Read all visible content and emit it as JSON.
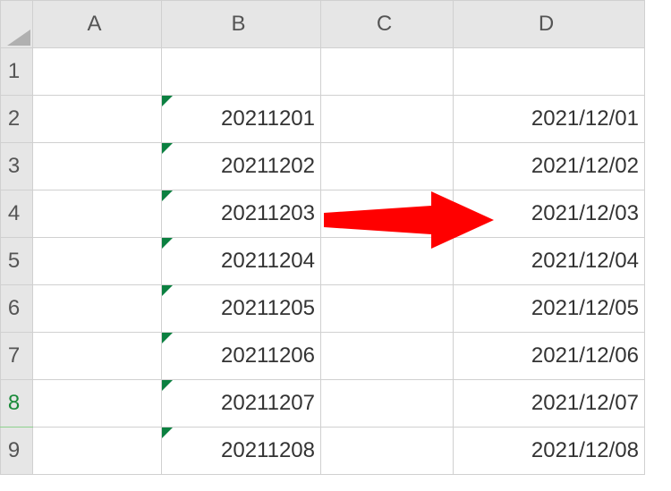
{
  "columns": {
    "A": "A",
    "B": "B",
    "C": "C",
    "D": "D"
  },
  "row_headers": [
    "1",
    "2",
    "3",
    "4",
    "5",
    "6",
    "7",
    "8",
    "9"
  ],
  "rows": [
    {
      "A": "",
      "B": "",
      "C": "",
      "D": ""
    },
    {
      "A": "",
      "B": "20211201",
      "C": "",
      "D": "2021/12/01"
    },
    {
      "A": "",
      "B": "20211202",
      "C": "",
      "D": "2021/12/02"
    },
    {
      "A": "",
      "B": "20211203",
      "C": "",
      "D": "2021/12/03"
    },
    {
      "A": "",
      "B": "20211204",
      "C": "",
      "D": "2021/12/04"
    },
    {
      "A": "",
      "B": "20211205",
      "C": "",
      "D": "2021/12/05"
    },
    {
      "A": "",
      "B": "20211206",
      "C": "",
      "D": "2021/12/06"
    },
    {
      "A": "",
      "B": "20211207",
      "C": "",
      "D": "2021/12/07"
    },
    {
      "A": "",
      "B": "20211208",
      "C": "",
      "D": "2021/12/08"
    }
  ],
  "annotation": {
    "type": "arrow",
    "color": "#ff0000",
    "from": "C4",
    "to": "D4",
    "meaning": "convert-text-to-date"
  }
}
